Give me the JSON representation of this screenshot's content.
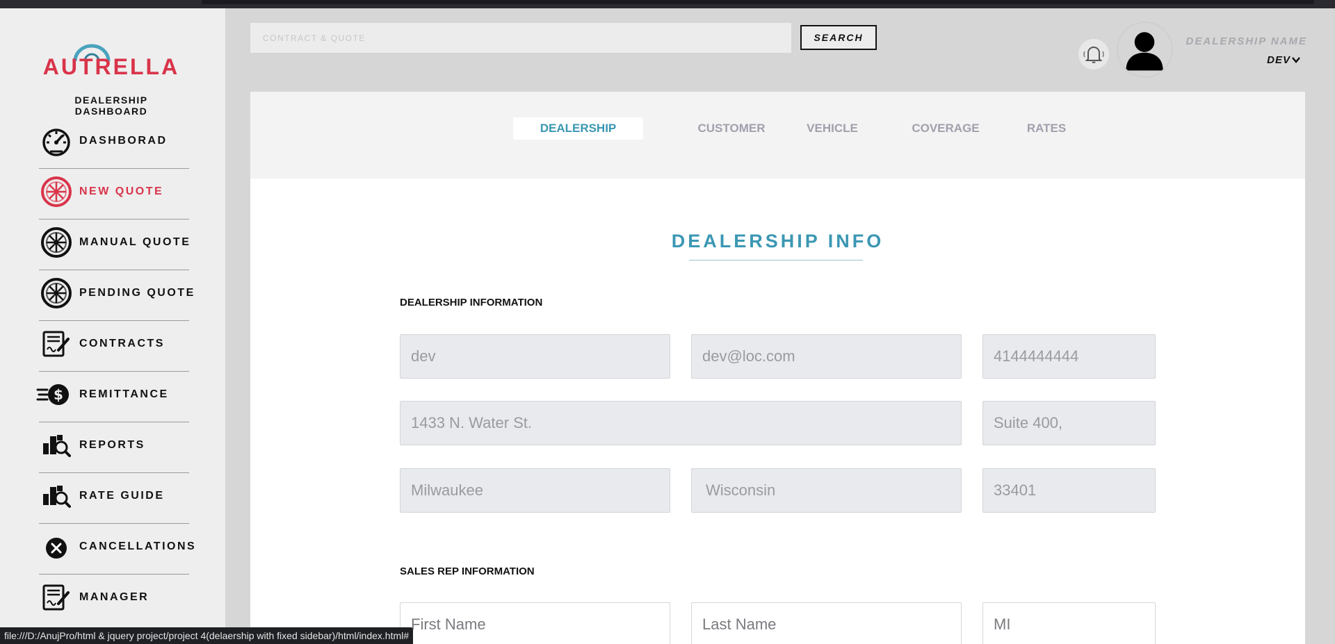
{
  "brand": {
    "name": "AUTRELLA",
    "subtitle": "DEALERSHIP DASHBOARD",
    "accent_color": "#d9344a",
    "teal_color": "#3b97b3"
  },
  "sidebar": {
    "items": [
      {
        "label": "DASHBORAD",
        "icon": "speedometer-icon"
      },
      {
        "label": "NEW QUOTE",
        "icon": "wheel-icon",
        "active": true
      },
      {
        "label": "MANUAL QUOTE",
        "icon": "wheel-icon"
      },
      {
        "label": "PENDING QUOTE",
        "icon": "wheel-icon"
      },
      {
        "label": "CONTRACTS",
        "icon": "contract-sign-icon"
      },
      {
        "label": "REMITTANCE",
        "icon": "dollar-coin-icon"
      },
      {
        "label": "REPORTS",
        "icon": "report-search-icon"
      },
      {
        "label": "RATE GUIDE",
        "icon": "report-search-icon"
      },
      {
        "label": "CANCELLATIONS",
        "icon": "cancel-icon"
      },
      {
        "label": "MANAGER",
        "icon": "contract-sign-icon"
      }
    ]
  },
  "header": {
    "search_placeholder": "CONTRACT & QUOTE",
    "search_button": "SEARCH",
    "dealer_name": "DEALERSHIP NAME",
    "user": "DEV"
  },
  "tabs": [
    {
      "label": "DEALERSHIP",
      "active": true
    },
    {
      "label": "CUSTOMER"
    },
    {
      "label": "VEHICLE"
    },
    {
      "label": "COVERAGE"
    },
    {
      "label": "RATES"
    }
  ],
  "main": {
    "title": "DEALERSHIP INFO",
    "dealership_heading": "DEALERSHIP INFORMATION",
    "dealership_fields": {
      "name": "dev",
      "email": "dev@loc.com",
      "phone": "4144444444",
      "address": "1433 N. Water St.",
      "suite": "Suite 400,",
      "city": "Milwaukee",
      "state": "Wisconsin",
      "zip": "33401"
    },
    "sales_rep_heading": "SALES REP INFORMATION",
    "sales_rep_placeholders": {
      "first_name": "First Name",
      "last_name": "Last Name",
      "mi": "MI"
    }
  },
  "status_url": "file:///D:/AnujPro/html & jquery project/project 4(delaership with fixed sidebar)/html/index.html#"
}
